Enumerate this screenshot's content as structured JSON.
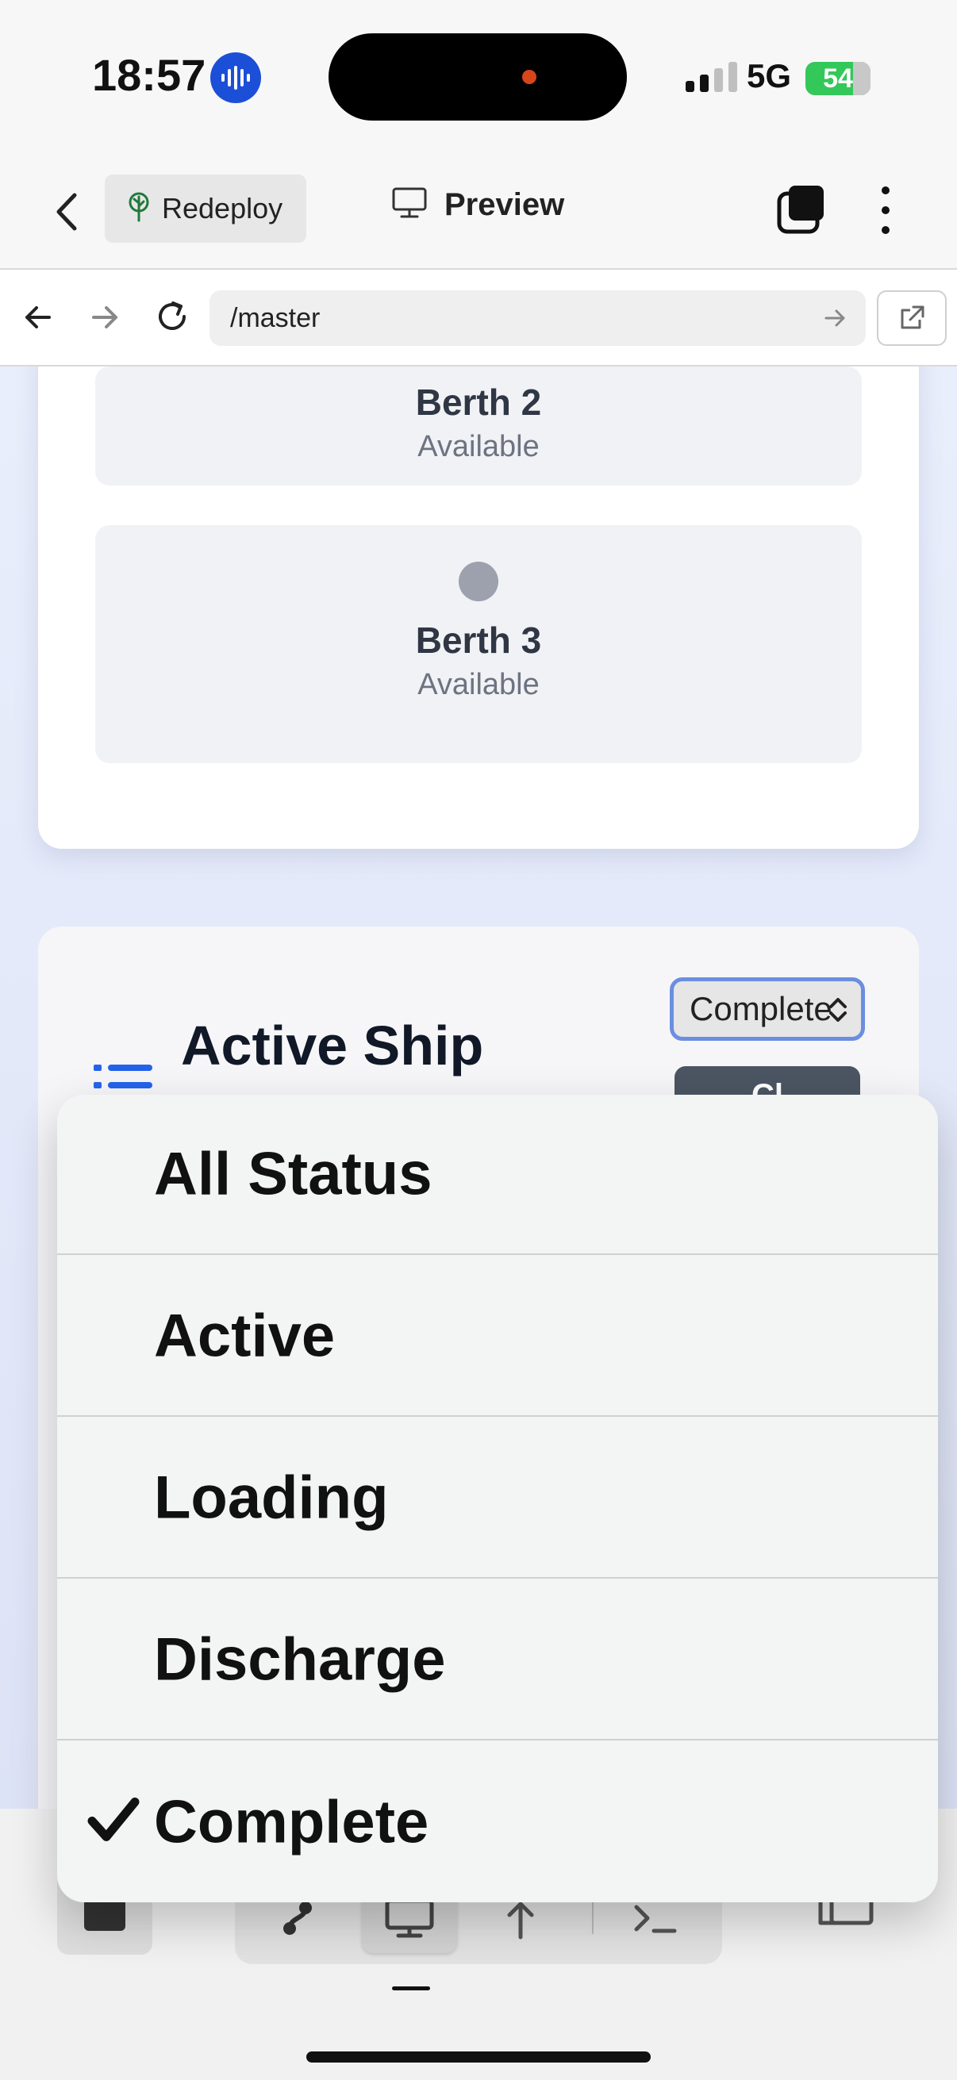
{
  "status_bar": {
    "time": "18:57",
    "network": "5G",
    "battery": "54",
    "voice_icon": "audio-waveform-icon",
    "signal_icon": "cellular-signal-icon"
  },
  "toolbar": {
    "back_icon": "chevron-left-icon",
    "redeploy_label": "Redeploy",
    "redeploy_icon": "tree-icon",
    "preview_label": "Preview",
    "preview_icon": "monitor-icon",
    "tabs_icon": "tabs-icon",
    "more_icon": "more-vertical-icon"
  },
  "url_bar": {
    "url": "/master",
    "back_icon": "arrow-left-icon",
    "forward_icon": "arrow-right-icon",
    "reload_icon": "reload-icon",
    "go_icon": "arrow-right-icon",
    "open_external_icon": "external-link-icon"
  },
  "berths": [
    {
      "name": "Berth 2",
      "status": "Available"
    },
    {
      "name": "Berth 3",
      "status": "Available"
    }
  ],
  "ship_panel": {
    "title": "Active Ship",
    "title_icon": "list-icon",
    "status_select_value": "Complete",
    "dark_button_label": "Cl"
  },
  "status_menu": {
    "options": [
      "All Status",
      "Active",
      "Loading",
      "Discharge",
      "Complete"
    ],
    "selected": "Complete",
    "check_icon": "checkmark-icon"
  },
  "bottom_bar": {
    "icons": [
      "stop-icon",
      "git-branch-icon",
      "monitor-icon",
      "deploy-icon",
      "terminal-icon",
      "files-icon"
    ],
    "active": "monitor-icon"
  },
  "colors": {
    "accent_blue": "#1c4fd8",
    "battery_green": "#34c759",
    "focus_ring": "#6b8ee0",
    "title_text": "#111827"
  }
}
